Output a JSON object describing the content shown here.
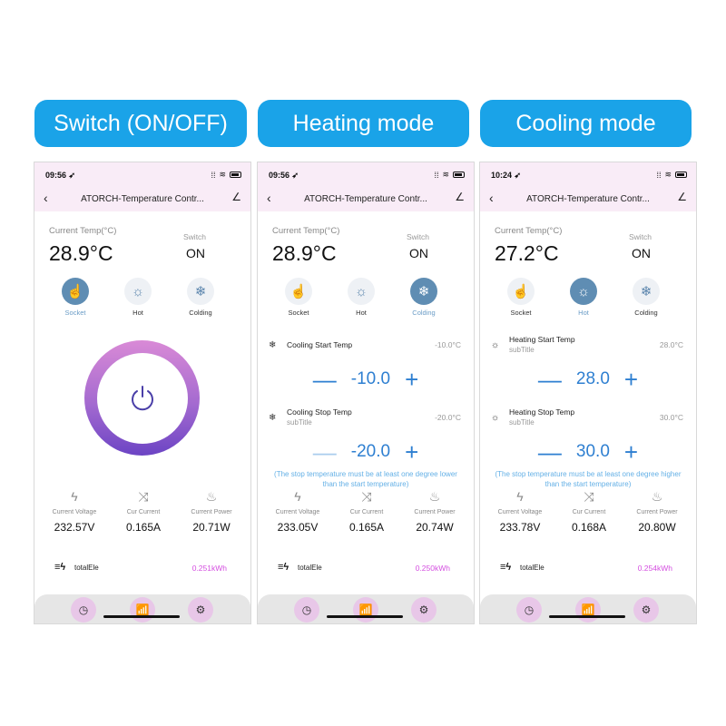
{
  "labels": [
    "Switch (ON/OFF)",
    "Heating mode",
    "Cooling mode"
  ],
  "screens": [
    {
      "time": "09:56",
      "title": "ATORCH-Temperature Contr...",
      "current_temp_label": "Current Temp(°C)",
      "current_temp": "28.9°C",
      "switch_label": "Switch",
      "switch_value": "ON",
      "modes": [
        {
          "label": "Socket",
          "icon": "hand-pointer-icon",
          "active": true
        },
        {
          "label": "Hot",
          "icon": "sun-icon",
          "active": false
        },
        {
          "label": "Colding",
          "icon": "snowflake-icon",
          "active": false
        }
      ],
      "metrics": [
        {
          "label": "Current Voltage",
          "value": "232.57V",
          "icon": "lightning-icon"
        },
        {
          "label": "Cur Current",
          "value": "0.165A",
          "icon": "shuffle-icon"
        },
        {
          "label": "Current Power",
          "value": "20.71W",
          "icon": "flame-icon"
        }
      ],
      "total_label": "totalEle",
      "total_value": "0.251kWh"
    },
    {
      "time": "09:56",
      "title": "ATORCH-Temperature Contr...",
      "current_temp_label": "Current Temp(°C)",
      "current_temp": "28.9°C",
      "switch_label": "Switch",
      "switch_value": "ON",
      "modes": [
        {
          "label": "Socket",
          "icon": "hand-pointer-icon",
          "active": false
        },
        {
          "label": "Hot",
          "icon": "sun-icon",
          "active": false
        },
        {
          "label": "Colding",
          "icon": "snowflake-icon",
          "active": true
        }
      ],
      "settings": [
        {
          "title": "Cooling Start Temp",
          "subtitle": "",
          "value": "-10.0°C",
          "stepper": "-10.0"
        },
        {
          "title": "Cooling Stop Temp",
          "subtitle": "subTitle",
          "value": "-20.0°C",
          "stepper": "-20.0"
        }
      ],
      "hint_line1": "(The stop temperature must be at least one degree lower",
      "hint_line2": "than the start temperature)",
      "metrics": [
        {
          "label": "Current Voltage",
          "value": "233.05V",
          "icon": "lightning-icon"
        },
        {
          "label": "Cur Current",
          "value": "0.165A",
          "icon": "shuffle-icon"
        },
        {
          "label": "Current Power",
          "value": "20.74W",
          "icon": "flame-icon"
        }
      ],
      "total_label": "totalEle",
      "total_value": "0.250kWh"
    },
    {
      "time": "10:24",
      "title": "ATORCH-Temperature Contr...",
      "current_temp_label": "Current Temp(°C)",
      "current_temp": "27.2°C",
      "switch_label": "Switch",
      "switch_value": "ON",
      "modes": [
        {
          "label": "Socket",
          "icon": "hand-pointer-icon",
          "active": false
        },
        {
          "label": "Hot",
          "icon": "sun-icon",
          "active": true
        },
        {
          "label": "Colding",
          "icon": "snowflake-icon",
          "active": false
        }
      ],
      "settings": [
        {
          "title": "Heating Start Temp",
          "subtitle": "subTitle",
          "value": "28.0°C",
          "stepper": "28.0"
        },
        {
          "title": "Heating Stop Temp",
          "subtitle": "subTitle",
          "value": "30.0°C",
          "stepper": "30.0"
        }
      ],
      "hint_line1": "(The stop temperature must be at least one degree higher",
      "hint_line2": "than the start temperature)",
      "metrics": [
        {
          "label": "Current Voltage",
          "value": "233.78V",
          "icon": "lightning-icon"
        },
        {
          "label": "Cur Current",
          "value": "0.168A",
          "icon": "shuffle-icon"
        },
        {
          "label": "Current Power",
          "value": "20.80W",
          "icon": "flame-icon"
        }
      ],
      "total_label": "totalEle",
      "total_value": "0.254kWh"
    }
  ],
  "glyphs": {
    "back": "‹",
    "edit": "∠",
    "minus": "—",
    "plus": "+",
    "socket": "☝",
    "sun": "☼",
    "snow": "❄",
    "bolt": "ϟ",
    "shuffle": "⤨",
    "flame": "♨",
    "total": "≡ϟ",
    "clock": "◷",
    "chart": "📶",
    "gear": "⚙",
    "wifi": "≋",
    "signal": "⁞⁞",
    "location": "➶"
  }
}
